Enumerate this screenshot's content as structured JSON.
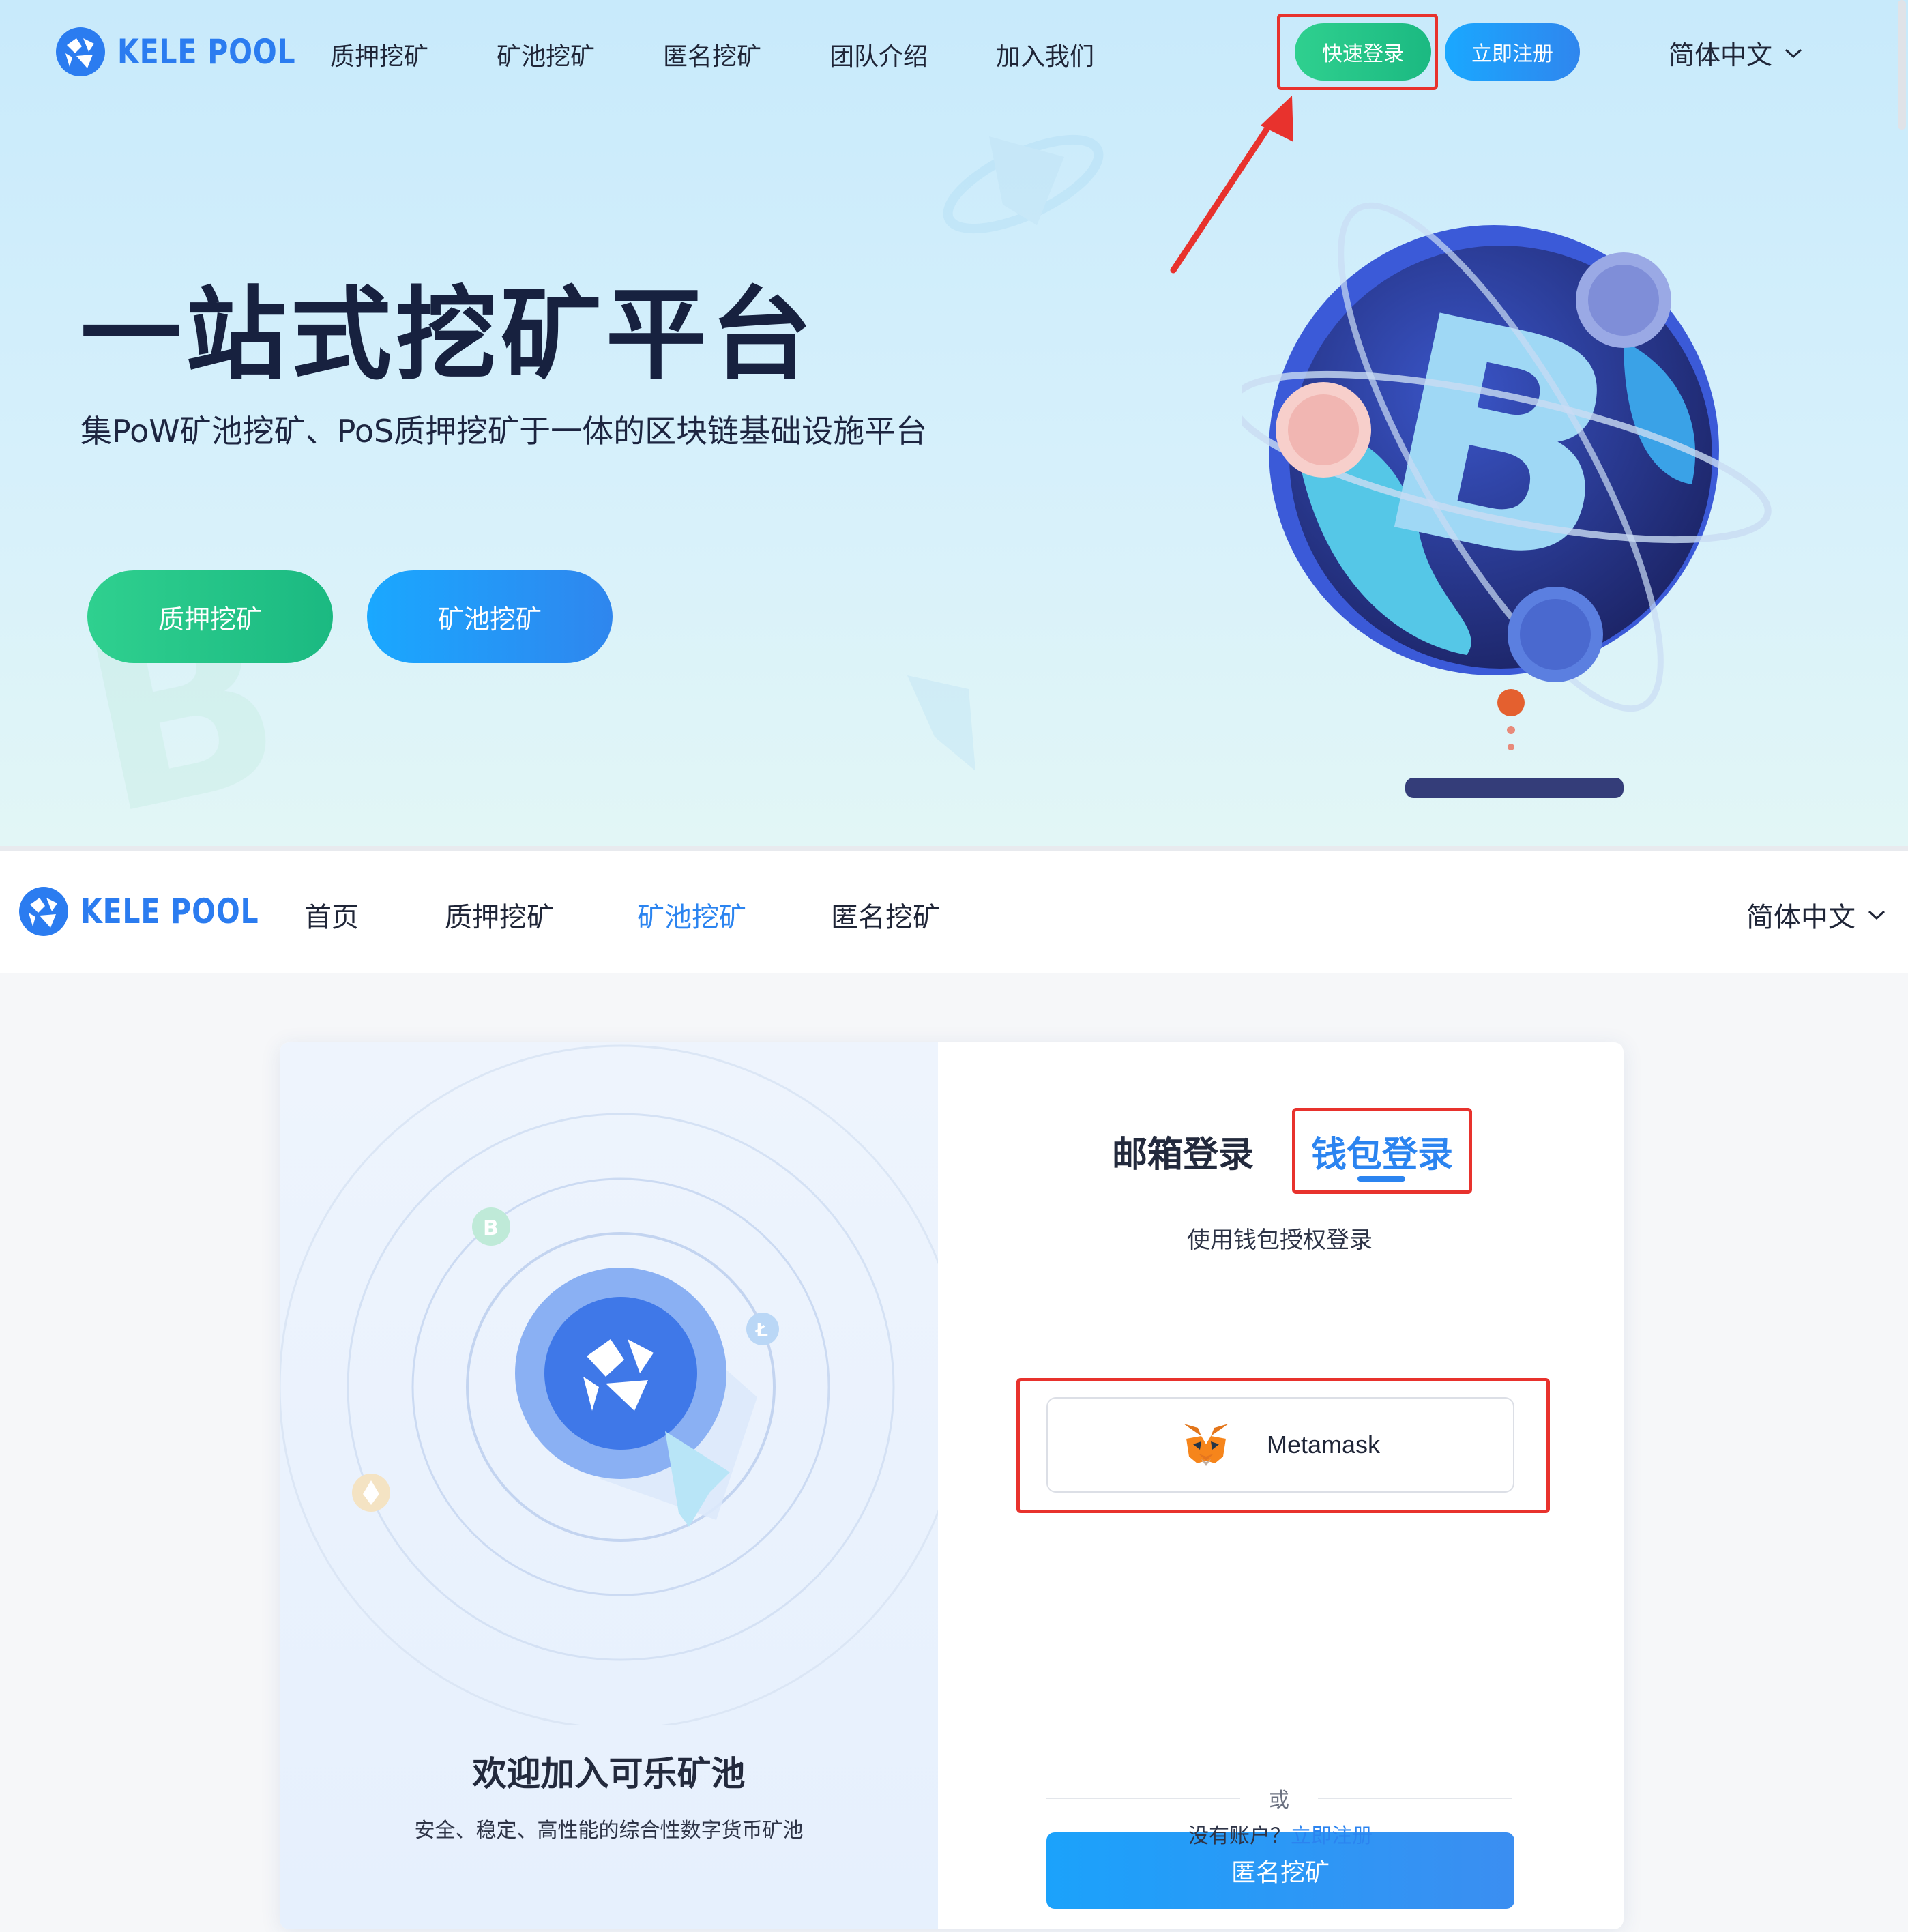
{
  "colors": {
    "brand_blue": "#2b84f0",
    "brand_green": "#1bb981",
    "annotation_red": "#e8322d",
    "title_dark": "#17213f"
  },
  "landing": {
    "logo_text": "KELE POOL",
    "nav": [
      "质押挖矿",
      "矿池挖矿",
      "匿名挖矿",
      "团队介绍",
      "加入我们"
    ],
    "quick_login": "快速登录",
    "register": "立即注册",
    "language": "简体中文",
    "hero_title": "一站式挖矿平台",
    "hero_subtitle": "集PoW矿池挖矿、PoS质押挖矿于一体的区块链基础设施平台",
    "cta_stake": "质押挖矿",
    "cta_pool": "矿池挖矿",
    "icons": {
      "logo": "kele-pool-logo-icon",
      "chevron": "chevron-down-icon",
      "globe": "bitcoin-globe-illustration",
      "arrow": "annotation-arrow-icon"
    }
  },
  "login_page": {
    "logo_text": "KELE POOL",
    "nav": [
      "首页",
      "质押挖矿",
      "矿池挖矿",
      "匿名挖矿"
    ],
    "active_nav": "矿池挖矿",
    "language": "简体中文",
    "welcome_title": "欢迎加入可乐矿池",
    "welcome_subtitle": "安全、稳定、高性能的综合性数字货币矿池",
    "tab_email": "邮箱登录",
    "tab_wallet": "钱包登录",
    "wallet_hint": "使用钱包授权登录",
    "wallet_option": "Metamask",
    "or_text": "或",
    "anon_button": "匿名挖矿",
    "no_account": "没有账户？",
    "register_link": "立即注册",
    "icons": {
      "metamask": "metamask-fox-icon",
      "illustration": "orbit-coins-illustration"
    }
  }
}
